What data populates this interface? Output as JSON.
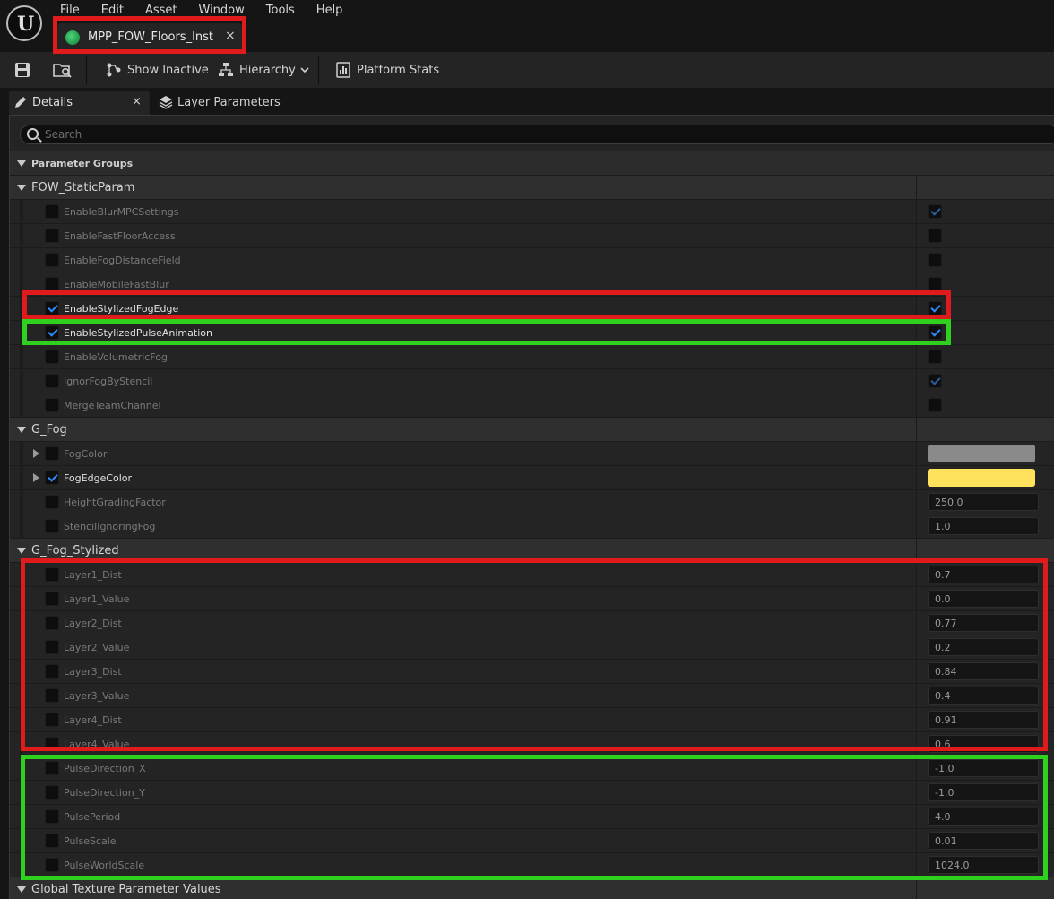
{
  "menu": [
    "File",
    "Edit",
    "Asset",
    "Window",
    "Tools",
    "Help"
  ],
  "asset_tab": {
    "label": "MPP_FOW_Floors_Inst",
    "close": "×",
    "icon": "material-instance-icon"
  },
  "toolbar": {
    "show_inactive": "Show Inactive",
    "hierarchy": "Hierarchy",
    "platform_stats": "Platform Stats"
  },
  "panel_tabs": {
    "details": "Details",
    "details_close": "×",
    "layer_parameters": "Layer Parameters"
  },
  "search": {
    "placeholder": "Search"
  },
  "parameter_groups_label": "Parameter Groups",
  "groups": {
    "fow_static": {
      "title": "FOW_StaticParam",
      "rows": [
        {
          "label": "EnableBlurMPCSettings",
          "override": false,
          "value": true
        },
        {
          "label": "EnableFastFloorAccess",
          "override": false,
          "value": false
        },
        {
          "label": "EnableFogDistanceField",
          "override": false,
          "value": false
        },
        {
          "label": "EnableMobileFastBlur",
          "override": false,
          "value": false
        },
        {
          "label": "EnableStylizedFogEdge",
          "override": true,
          "value": true
        },
        {
          "label": "EnableStylizedPulseAnimation",
          "override": true,
          "value": true
        },
        {
          "label": "EnableVolumetricFog",
          "override": false,
          "value": false
        },
        {
          "label": "IgnorFogByStencil",
          "override": false,
          "value": true
        },
        {
          "label": "MergeTeamChannel",
          "override": false,
          "value": false
        }
      ]
    },
    "g_fog": {
      "title": "G_Fog",
      "rows": [
        {
          "label": "FogColor",
          "override": false,
          "color": "#8a8a8a"
        },
        {
          "label": "FogEdgeColor",
          "override": true,
          "color": "#ffe25c"
        },
        {
          "label": "HeightGradingFactor",
          "override": false,
          "value": "250.0"
        },
        {
          "label": "StencilIgnoringFog",
          "override": false,
          "value": "1.0"
        }
      ]
    },
    "g_fog_stylized": {
      "title": "G_Fog_Stylized",
      "rows": [
        {
          "label": "Layer1_Dist",
          "value": "0.7"
        },
        {
          "label": "Layer1_Value",
          "value": "0.0"
        },
        {
          "label": "Layer2_Dist",
          "value": "0.77"
        },
        {
          "label": "Layer2_Value",
          "value": "0.2"
        },
        {
          "label": "Layer3_Dist",
          "value": "0.84"
        },
        {
          "label": "Layer3_Value",
          "value": "0.4"
        },
        {
          "label": "Layer4_Dist",
          "value": "0.91"
        },
        {
          "label": "Layer4_Value",
          "value": "0.6"
        },
        {
          "label": "PulseDirection_X",
          "value": "-1.0"
        },
        {
          "label": "PulseDirection_Y",
          "value": "-1.0"
        },
        {
          "label": "PulsePeriod",
          "value": "4.0"
        },
        {
          "label": "PulseScale",
          "value": "0.01"
        },
        {
          "label": "PulseWorldScale",
          "value": "1024.0"
        }
      ]
    },
    "global_texture": {
      "title": "Global Texture Parameter Values"
    }
  },
  "colors": {
    "highlight_red": "#e01b1b",
    "highlight_green": "#2ed11e",
    "accent": "#2d8cff"
  }
}
